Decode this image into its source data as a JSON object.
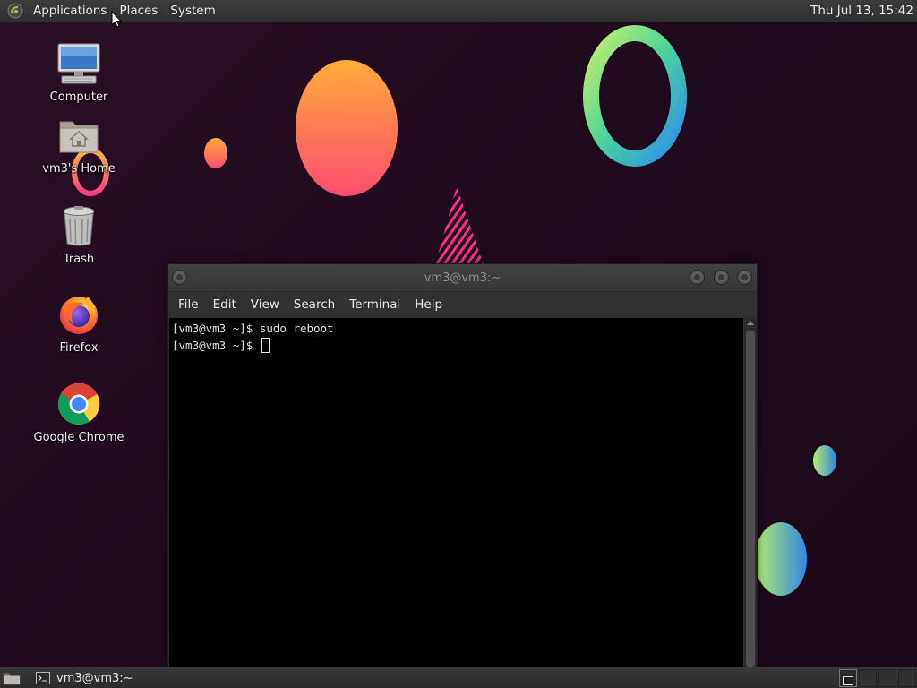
{
  "top_panel": {
    "menus": [
      "Applications",
      "Places",
      "System"
    ],
    "clock": "Thu Jul 13, 15:42",
    "logo_icon": "mate-logo-icon"
  },
  "desktop_icons": [
    {
      "label": "Computer",
      "icon": "computer-icon"
    },
    {
      "label": "vm3's Home",
      "icon": "home-folder-icon"
    },
    {
      "label": "Trash",
      "icon": "trash-icon"
    },
    {
      "label": "Firefox",
      "icon": "firefox-icon"
    },
    {
      "label": "Google Chrome",
      "icon": "chrome-icon"
    }
  ],
  "terminal": {
    "title": "vm3@vm3:~",
    "menus": [
      "File",
      "Edit",
      "View",
      "Search",
      "Terminal",
      "Help"
    ],
    "lines": [
      "[vm3@vm3 ~]$ sudo reboot",
      "[vm3@vm3 ~]$ "
    ]
  },
  "bottom_panel": {
    "task_label": "vm3@vm3:~",
    "task_icon": "terminal-icon",
    "show_desktop_icon": "show-desktop-icon"
  },
  "colors": {
    "wallpaper": "#220c1f",
    "panel": "#353535",
    "terminal_bg": "#000000",
    "accent_pink": "#ff3d7f",
    "accent_orange": "#ffa23a"
  }
}
